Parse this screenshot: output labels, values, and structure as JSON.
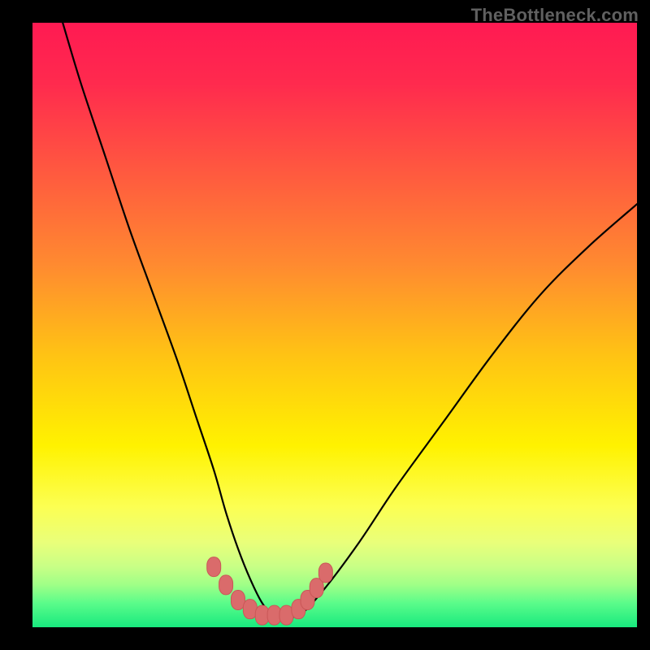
{
  "watermark": "TheBottleneck.com",
  "colors": {
    "frame": "#000000",
    "gradient_stops": [
      {
        "offset": 0.0,
        "color": "#ff1a52"
      },
      {
        "offset": 0.1,
        "color": "#ff2a4e"
      },
      {
        "offset": 0.25,
        "color": "#ff5a3f"
      },
      {
        "offset": 0.4,
        "color": "#ff8a30"
      },
      {
        "offset": 0.55,
        "color": "#ffc314"
      },
      {
        "offset": 0.7,
        "color": "#fff200"
      },
      {
        "offset": 0.8,
        "color": "#fcff52"
      },
      {
        "offset": 0.86,
        "color": "#e9ff7a"
      },
      {
        "offset": 0.9,
        "color": "#c8ff86"
      },
      {
        "offset": 0.93,
        "color": "#9fff87"
      },
      {
        "offset": 0.96,
        "color": "#5bfc8a"
      },
      {
        "offset": 1.0,
        "color": "#18e97e"
      }
    ],
    "curve": "#000000",
    "marker_fill": "#da6b6b",
    "marker_stroke": "#c95757"
  },
  "chart_data": {
    "type": "line",
    "title": "",
    "xlabel": "",
    "ylabel": "",
    "xlim": [
      0,
      100
    ],
    "ylim": [
      0,
      100
    ],
    "grid": false,
    "legend": false,
    "series": [
      {
        "name": "bottleneck-curve",
        "x": [
          5,
          8,
          12,
          16,
          20,
          24,
          27,
          30,
          32,
          34,
          36,
          38,
          40,
          44,
          48,
          54,
          60,
          68,
          76,
          84,
          92,
          100
        ],
        "y": [
          100,
          90,
          78,
          66,
          55,
          44,
          35,
          26,
          19,
          13,
          8,
          4,
          2,
          2,
          6,
          14,
          23,
          34,
          45,
          55,
          63,
          70
        ]
      }
    ],
    "markers": {
      "name": "highlight-points",
      "x": [
        30,
        32,
        34,
        36,
        38,
        40,
        42,
        44,
        45.5,
        47,
        48.5
      ],
      "y": [
        10,
        7,
        4.5,
        3,
        2,
        2,
        2,
        3,
        4.5,
        6.5,
        9
      ]
    }
  }
}
